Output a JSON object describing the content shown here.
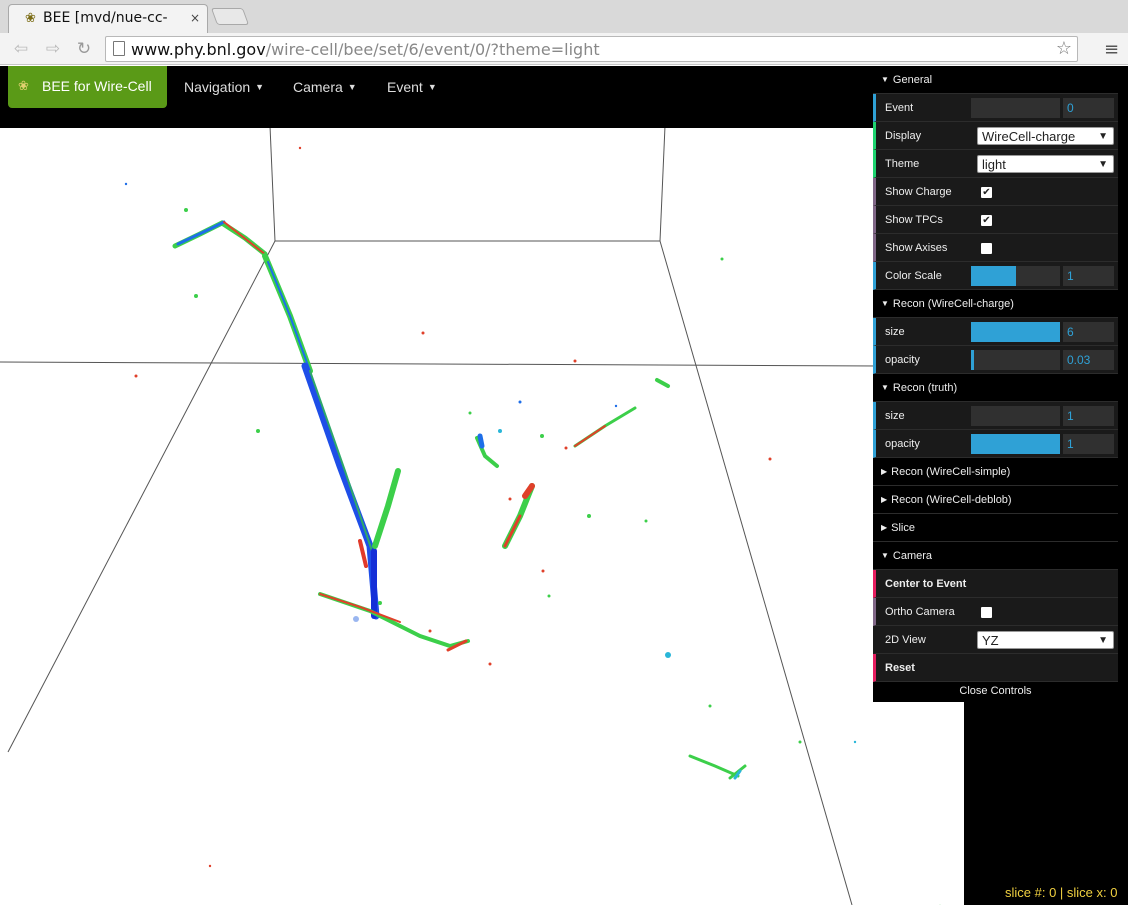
{
  "browser": {
    "tab_title": "BEE [mvd/nue-cc-",
    "tab_close": "×",
    "url_host": "www.phy.bnl.gov",
    "url_path": "/wire-cell/bee/set/6/event/0/?theme=light"
  },
  "navbar": {
    "brand": "BEE for Wire-Cell",
    "menus": [
      "Navigation",
      "Camera",
      "Event"
    ]
  },
  "gui": {
    "general": {
      "title": "General",
      "event": {
        "label": "Event",
        "value": "0",
        "fraction": 0
      },
      "display": {
        "label": "Display",
        "value": "WireCell-charge"
      },
      "theme": {
        "label": "Theme",
        "value": "light"
      },
      "show_charge": {
        "label": "Show Charge",
        "checked": true
      },
      "show_tpcs": {
        "label": "Show TPCs",
        "checked": true
      },
      "show_axises": {
        "label": "Show Axises",
        "checked": false
      },
      "color_scale": {
        "label": "Color Scale",
        "value": "1",
        "fraction": 0.5
      }
    },
    "recon_charge": {
      "title": "Recon (WireCell-charge)",
      "size": {
        "label": "size",
        "value": "6",
        "fraction": 1.0
      },
      "opacity": {
        "label": "opacity",
        "value": "0.03",
        "fraction": 0.03
      }
    },
    "recon_truth": {
      "title": "Recon (truth)",
      "size": {
        "label": "size",
        "value": "1",
        "fraction": 0
      },
      "opacity": {
        "label": "opacity",
        "value": "1",
        "fraction": 1.0
      }
    },
    "collapsed": [
      "Recon (WireCell-simple)",
      "Recon (WireCell-deblob)",
      "Slice"
    ],
    "camera": {
      "title": "Camera",
      "center": "Center to Event",
      "ortho": {
        "label": "Ortho Camera",
        "checked": false
      },
      "view2d": {
        "label": "2D View",
        "value": "YZ"
      },
      "reset": "Reset"
    },
    "close": "Close Controls"
  },
  "status": {
    "slice_info": "slice #: 0 | slice x: 0"
  },
  "colors": {
    "accent": "#2fa1d6",
    "brand": "#5a9a17",
    "slice_info": "#f0d040"
  },
  "icons": {
    "favicon": "bee-icon",
    "brand": "bee-icon",
    "back": "back-arrow-icon",
    "forward": "forward-arrow-icon",
    "reload": "reload-icon",
    "bookmark": "star-icon",
    "menu": "hamburger-menu-icon"
  }
}
